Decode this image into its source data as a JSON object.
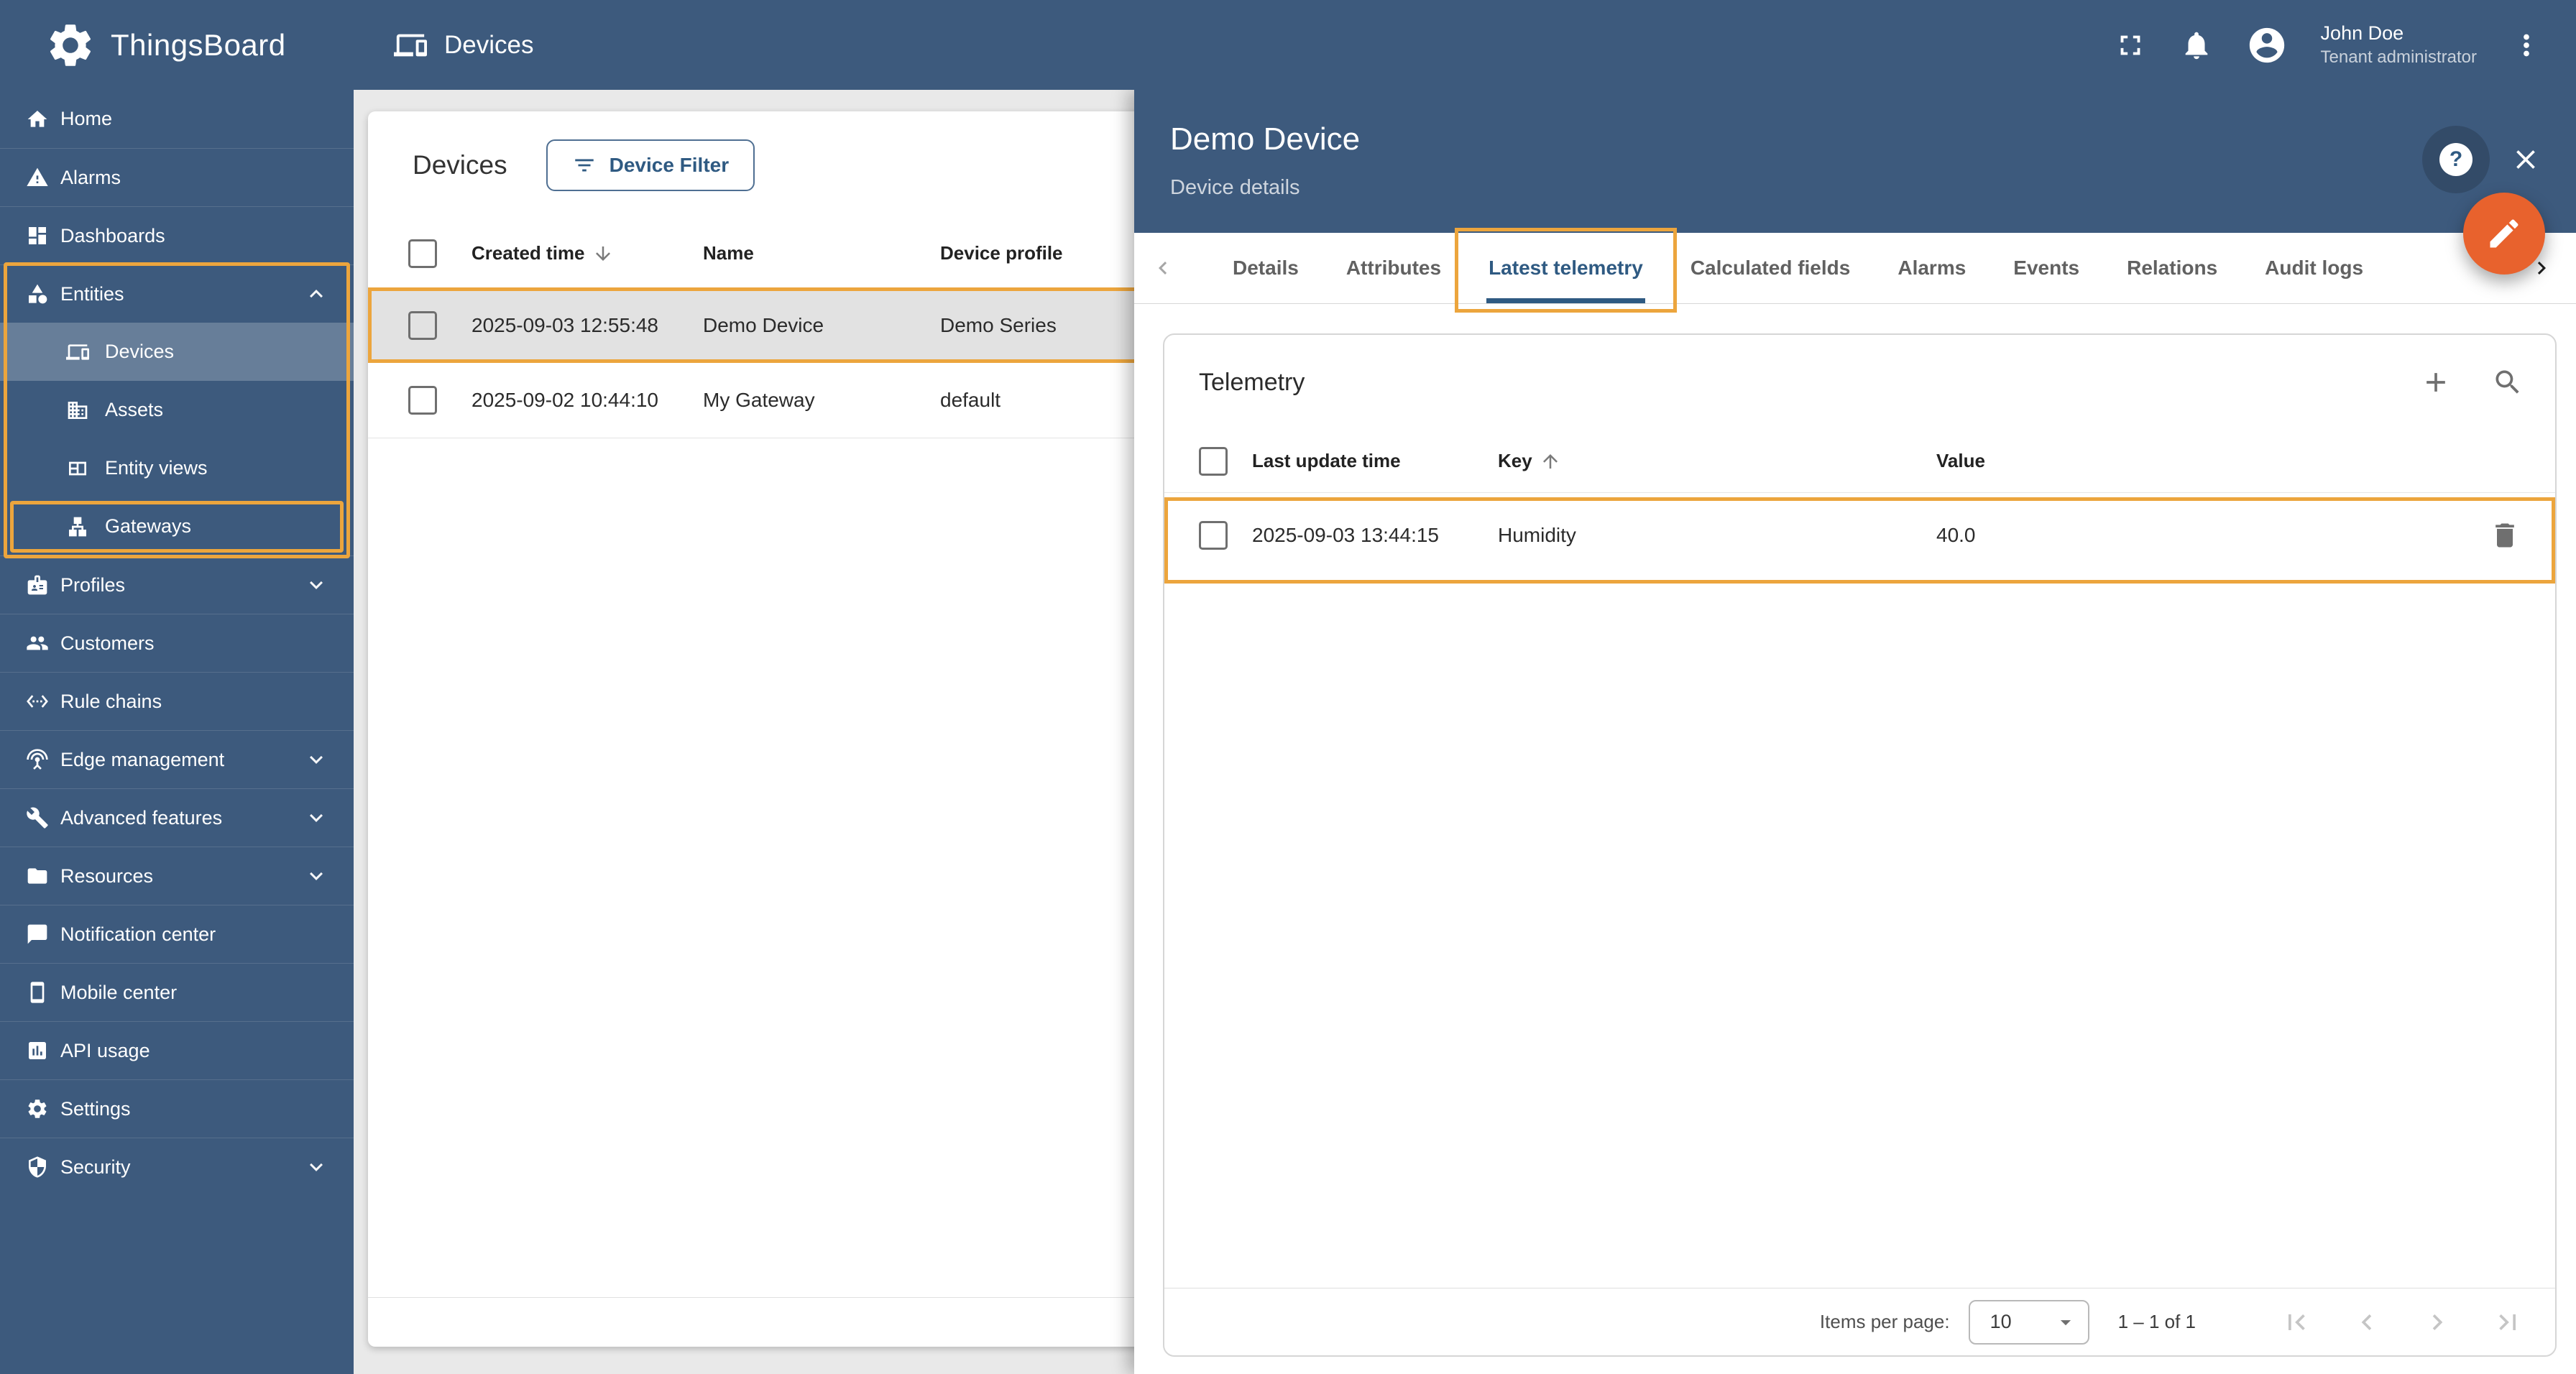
{
  "app": {
    "brand": "ThingsBoard",
    "page_title": "Devices"
  },
  "topbar": {
    "user_name": "John Doe",
    "user_role": "Tenant administrator",
    "icons": [
      "fullscreen",
      "notifications",
      "account-circle",
      "more-vert"
    ]
  },
  "colors": {
    "primary_blue": "#3D5A7D",
    "link_blue": "#2F5A82",
    "highlight_orange": "#ECA53D",
    "fab_orange": "#E8622D",
    "page_background": "#E9E9E9",
    "selected_row_gray": "#E2E2E2"
  },
  "sidebar": {
    "items": [
      {
        "label": "Home",
        "icon": "home"
      },
      {
        "label": "Alarms",
        "icon": "warning"
      },
      {
        "label": "Dashboards",
        "icon": "dashboard"
      },
      {
        "label": "Entities",
        "icon": "category",
        "expanded": true,
        "highlighted": true,
        "children": [
          {
            "label": "Devices",
            "icon": "devices",
            "selected": true
          },
          {
            "label": "Assets",
            "icon": "domain"
          },
          {
            "label": "Entity views",
            "icon": "view-quilt"
          },
          {
            "label": "Gateways",
            "icon": "lan",
            "highlighted": true
          }
        ]
      },
      {
        "label": "Profiles",
        "icon": "badge",
        "expandable": true
      },
      {
        "label": "Customers",
        "icon": "people"
      },
      {
        "label": "Rule chains",
        "icon": "rule-chain"
      },
      {
        "label": "Edge management",
        "icon": "antenna",
        "expandable": true
      },
      {
        "label": "Advanced features",
        "icon": "tools",
        "expandable": true
      },
      {
        "label": "Resources",
        "icon": "folder",
        "expandable": true
      },
      {
        "label": "Notification center",
        "icon": "chat"
      },
      {
        "label": "Mobile center",
        "icon": "smartphone"
      },
      {
        "label": "API usage",
        "icon": "chart-card"
      },
      {
        "label": "Settings",
        "icon": "gear"
      },
      {
        "label": "Security",
        "icon": "shield",
        "expandable": true
      }
    ]
  },
  "devices_panel": {
    "title": "Devices",
    "filter_button_label": "Device Filter",
    "columns": [
      "Created time",
      "Name",
      "Device profile"
    ],
    "sort": {
      "column": "Created time",
      "direction": "desc"
    },
    "rows": [
      {
        "created_time": "2025-09-03 12:55:48",
        "name": "Demo Device",
        "device_profile": "Demo Series",
        "highlighted": true
      },
      {
        "created_time": "2025-09-02 10:44:10",
        "name": "My Gateway",
        "device_profile": "default",
        "highlighted": false
      }
    ]
  },
  "details_panel": {
    "title": "Demo Device",
    "subtitle": "Device details",
    "help_glyph": "?",
    "tabs": [
      "Details",
      "Attributes",
      "Latest telemetry",
      "Calculated fields",
      "Alarms",
      "Events",
      "Relations",
      "Audit logs"
    ],
    "active_tab": "Latest telemetry",
    "telemetry": {
      "title": "Telemetry",
      "columns": [
        "Last update time",
        "Key",
        "Value"
      ],
      "sort": {
        "column": "Key",
        "direction": "asc"
      },
      "rows": [
        {
          "last_update_time": "2025-09-03 13:44:15",
          "key": "Humidity",
          "value": "40.0"
        }
      ],
      "pagination": {
        "items_per_page_label": "Items per page:",
        "items_per_page": "10",
        "range": "1 – 1 of 1"
      }
    }
  }
}
